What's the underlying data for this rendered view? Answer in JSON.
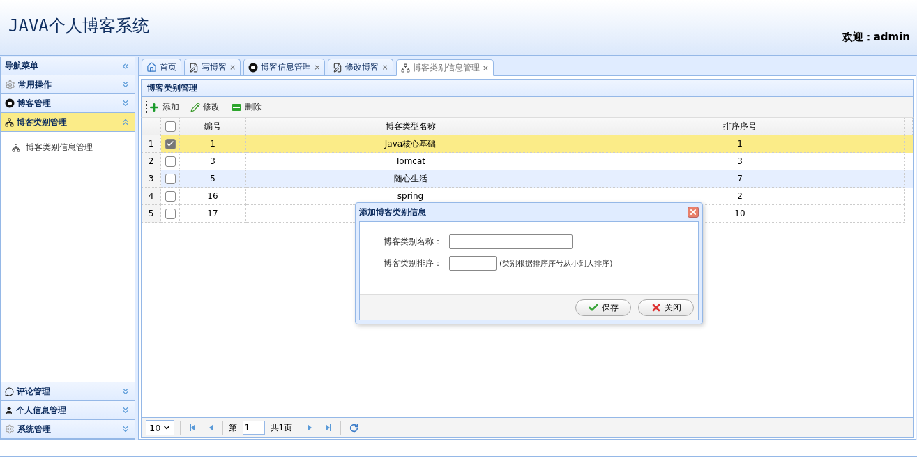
{
  "header": {
    "title": "JAVA个人博客系统",
    "welcome": "欢迎：admin"
  },
  "nav": {
    "title": "导航菜单",
    "sections": [
      {
        "label": "常用操作",
        "expanded": false,
        "selected": false
      },
      {
        "label": "博客管理",
        "expanded": false,
        "selected": false
      },
      {
        "label": "博客类别管理",
        "expanded": true,
        "selected": true,
        "children": [
          {
            "label": "博客类别信息管理"
          }
        ]
      },
      {
        "label": "评论管理",
        "expanded": false,
        "selected": false
      },
      {
        "label": "个人信息管理",
        "expanded": false,
        "selected": false
      },
      {
        "label": "系统管理",
        "expanded": false,
        "selected": false
      }
    ]
  },
  "tabs": [
    {
      "label": "首页",
      "selected": false
    },
    {
      "label": "写博客",
      "close": "×",
      "selected": false
    },
    {
      "label": "博客信息管理",
      "close": "×",
      "selected": false
    },
    {
      "label": "修改博客",
      "close": "×",
      "selected": false
    },
    {
      "label": "博客类别信息管理",
      "close": "×",
      "selected": true
    }
  ],
  "panel": {
    "title": "博客类别管理",
    "toolbar": [
      {
        "label": "添加"
      },
      {
        "label": "修改"
      },
      {
        "label": "删除"
      }
    ],
    "grid": {
      "header_checked": false,
      "columns": [
        "编号",
        "博客类型名称",
        "排序序号"
      ],
      "rows": [
        {
          "num": "1",
          "checked": true,
          "selected": true,
          "hovered": false,
          "cells": [
            "1",
            "Java核心基础",
            "1"
          ]
        },
        {
          "num": "2",
          "checked": false,
          "selected": false,
          "hovered": false,
          "cells": [
            "3",
            "Tomcat",
            "3"
          ]
        },
        {
          "num": "3",
          "checked": false,
          "selected": false,
          "hovered": true,
          "cells": [
            "5",
            "随心生活",
            "7"
          ]
        },
        {
          "num": "4",
          "checked": false,
          "selected": false,
          "hovered": false,
          "cells": [
            "16",
            "spring",
            "2"
          ]
        },
        {
          "num": "5",
          "checked": false,
          "selected": false,
          "hovered": false,
          "cells": [
            "17",
            "",
            "10"
          ]
        }
      ]
    },
    "pager": {
      "page_size": "10",
      "before": "第",
      "page": "1",
      "total": "共1页"
    }
  },
  "dialog": {
    "title": "添加博客类别信息",
    "fields": [
      {
        "label": "博客类别名称：",
        "kind": "wide"
      },
      {
        "label": "博客类别排序：",
        "kind": "short",
        "hint": "(类别根据排序序号从小到大排序)"
      }
    ],
    "buttons": [
      {
        "label": "保存",
        "kind": "save"
      },
      {
        "label": "关闭",
        "kind": "close"
      }
    ]
  }
}
